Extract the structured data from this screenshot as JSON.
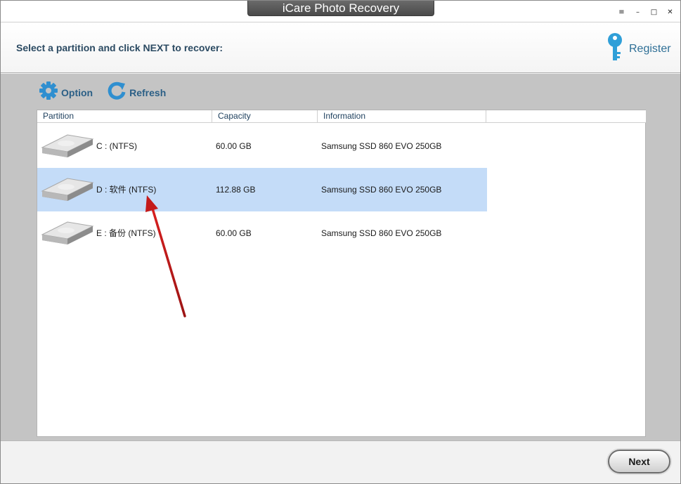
{
  "window": {
    "title": "iCare Photo Recovery"
  },
  "win_controls": {
    "menu": "≡",
    "minimize": "–",
    "maximize": "□",
    "close": "✕"
  },
  "header": {
    "instruction": "Select a partition and click NEXT to recover:",
    "register_label": "Register"
  },
  "toolbar": {
    "option_label": "Option",
    "refresh_label": "Refresh"
  },
  "table": {
    "columns": [
      "Partition",
      "Capacity",
      "Information"
    ],
    "rows": [
      {
        "partition": "C :   (NTFS)",
        "capacity": "60.00 GB",
        "information": "Samsung SSD 860 EVO 250GB",
        "selected": false
      },
      {
        "partition": "D : 软件  (NTFS)",
        "capacity": "112.88 GB",
        "information": "Samsung SSD 860 EVO 250GB",
        "selected": true
      },
      {
        "partition": "E : 备份  (NTFS)",
        "capacity": "60.00 GB",
        "information": "Samsung SSD 860 EVO 250GB",
        "selected": false
      }
    ]
  },
  "footer": {
    "next_label": "Next"
  },
  "colors": {
    "accent": "#2b5f86",
    "selected_row": "#c4dcf8",
    "annotation_arrow": "#c41a1a"
  },
  "icons": [
    "menu-icon",
    "minimize-icon",
    "maximize-icon",
    "close-icon",
    "key-icon",
    "gear-icon",
    "refresh-icon",
    "hard-drive-icon"
  ]
}
